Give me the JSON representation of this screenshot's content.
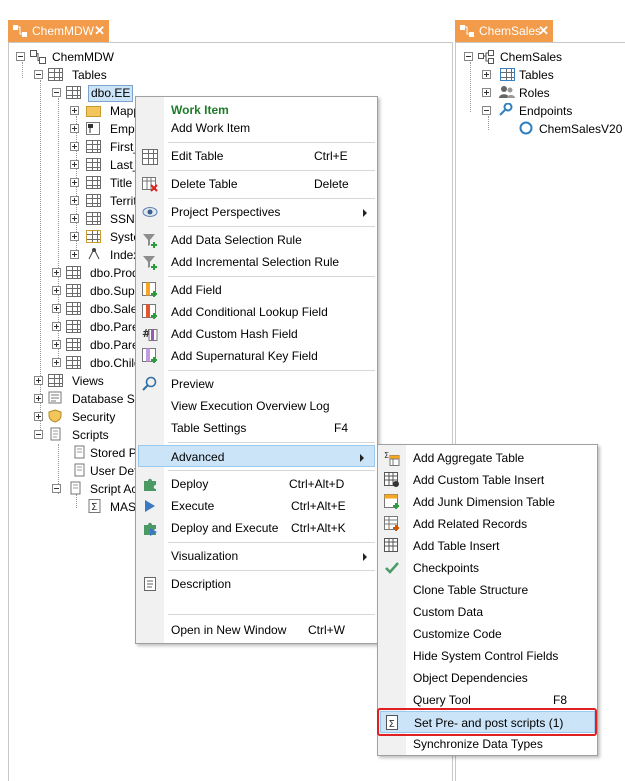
{
  "left_panel": {
    "tab_label": "ChemMDW",
    "tree": [
      {
        "label": "ChemMDW"
      },
      {
        "label": "Tables"
      },
      {
        "label": "dbo.EE"
      },
      {
        "label": "Mapp"
      },
      {
        "label": "Emplo"
      },
      {
        "label": "First_"
      },
      {
        "label": "Last_"
      },
      {
        "label": "Title ("
      },
      {
        "label": "Territ"
      },
      {
        "label": "SSN"
      },
      {
        "label": "Syste"
      },
      {
        "label": "Index"
      },
      {
        "label": "dbo.Produ"
      },
      {
        "label": "dbo.Suppl"
      },
      {
        "label": "dbo.Sales"
      },
      {
        "label": "dbo.Paren"
      },
      {
        "label": "dbo.Paren"
      },
      {
        "label": "dbo.Child"
      },
      {
        "label": "Views"
      },
      {
        "label": "Database Sch"
      },
      {
        "label": "Security"
      },
      {
        "label": "Scripts"
      },
      {
        "label": "Stored Pr"
      },
      {
        "label": "User Defi"
      },
      {
        "label": "Script Act"
      },
      {
        "label": "MASI"
      }
    ]
  },
  "right_panel": {
    "tab_label": "ChemSales",
    "tree": [
      {
        "label": "ChemSales"
      },
      {
        "label": "Tables"
      },
      {
        "label": "Roles"
      },
      {
        "label": "Endpoints"
      },
      {
        "label": "ChemSalesV20"
      }
    ]
  },
  "context_menu": {
    "items": [
      {
        "label": "Work Item",
        "shortcut": ""
      },
      {
        "label": "Add Work Item",
        "shortcut": ""
      },
      {
        "label": "Edit Table",
        "shortcut": "Ctrl+E"
      },
      {
        "label": "Delete Table",
        "shortcut": "Delete"
      },
      {
        "label": "Project Perspectives",
        "shortcut": ""
      },
      {
        "label": "Add Data Selection Rule",
        "shortcut": ""
      },
      {
        "label": "Add Incremental Selection Rule",
        "shortcut": ""
      },
      {
        "label": "Add Field",
        "shortcut": ""
      },
      {
        "label": "Add Conditional Lookup Field",
        "shortcut": ""
      },
      {
        "label": "Add Custom Hash Field",
        "shortcut": ""
      },
      {
        "label": "Add Supernatural Key Field",
        "shortcut": ""
      },
      {
        "label": "Preview",
        "shortcut": ""
      },
      {
        "label": "View Execution Overview Log",
        "shortcut": ""
      },
      {
        "label": "Table Settings",
        "shortcut": "F4"
      },
      {
        "label": "Advanced",
        "shortcut": ""
      },
      {
        "label": "Deploy",
        "shortcut": "Ctrl+Alt+D"
      },
      {
        "label": "Execute",
        "shortcut": "Ctrl+Alt+E"
      },
      {
        "label": "Deploy and Execute",
        "shortcut": "Ctrl+Alt+K"
      },
      {
        "label": "Visualization",
        "shortcut": ""
      },
      {
        "label": "Description",
        "shortcut": ""
      },
      {
        "label": "Open in New Window",
        "shortcut": "Ctrl+W"
      }
    ]
  },
  "submenu": {
    "items": [
      {
        "label": "Add Aggregate Table"
      },
      {
        "label": "Add Custom Table Insert"
      },
      {
        "label": "Add Junk Dimension Table"
      },
      {
        "label": "Add Related Records"
      },
      {
        "label": "Add Table Insert"
      },
      {
        "label": "Checkpoints"
      },
      {
        "label": "Clone Table Structure"
      },
      {
        "label": "Custom Data"
      },
      {
        "label": "Customize Code"
      },
      {
        "label": "Hide System Control Fields"
      },
      {
        "label": "Object Dependencies"
      },
      {
        "label": "Query Tool",
        "shortcut": "F8"
      },
      {
        "label": "Set Pre- and post scripts (1)"
      },
      {
        "label": "Synchronize Data Types"
      }
    ]
  },
  "colors": {
    "tab_orange": "#f29b4a",
    "work_item_green": "#1e7b2a",
    "highlight_blue": "#cce4f7",
    "annotation_red": "#e02020"
  }
}
